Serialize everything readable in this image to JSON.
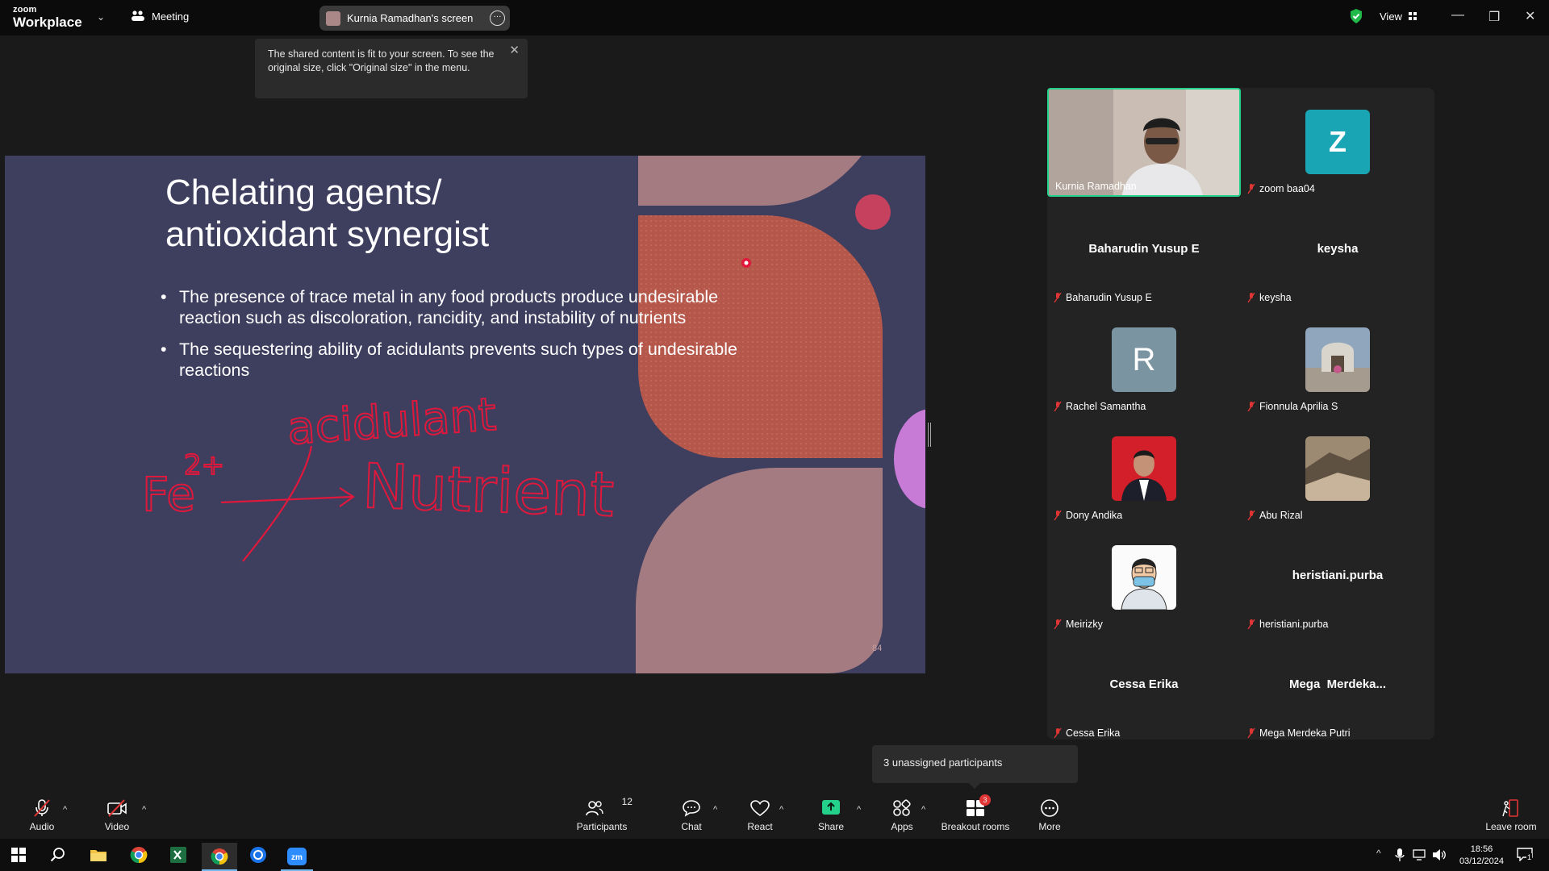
{
  "app": {
    "logo_line1": "zoom",
    "logo_line2": "Workplace"
  },
  "header": {
    "meeting_label": "Meeting",
    "screen_share_label": "Kurnia Ramadhan's screen",
    "view_label": "View"
  },
  "tooltip": {
    "text": "The shared content is fit to your screen. To see the original size, click \"Original size\" in the menu."
  },
  "slide": {
    "title_line1": "Chelating agents/",
    "title_line2": "antioxidant synergist",
    "bullets": [
      "The presence of trace metal in any food products produce undesirable reaction such as discoloration, rancidity, and instability of nutrients",
      "The sequestering ability of acidulants prevents such types of undesirable reactions"
    ],
    "annotation": {
      "top": "acidulant",
      "left": "Fe",
      "sup": "2+",
      "right": "Nutrient"
    },
    "page_number": "84",
    "colors": {
      "background": "#3e3e5f",
      "rust": "#b5574a",
      "pink": "#a47b80",
      "magenta": "#c5415d",
      "violet": "#c77bd6",
      "ink": "#e0183c"
    }
  },
  "gallery": {
    "tiles": [
      {
        "name": "Kurnia Ramadhan",
        "type": "video",
        "active": true
      },
      {
        "name": "zoom baa04",
        "type": "letter",
        "letter": "Z",
        "color": "#1aa5b4"
      },
      {
        "name": "Baharudin Yusup E",
        "type": "text",
        "center": "Baharudin Yusup E"
      },
      {
        "name": "keysha",
        "type": "text",
        "center": "keysha"
      },
      {
        "name": "Rachel Samantha",
        "type": "letter",
        "letter": "R",
        "color": "#7a95a1"
      },
      {
        "name": "Fionnula Aprilia S",
        "type": "photo"
      },
      {
        "name": "Dony Andika",
        "type": "photo"
      },
      {
        "name": "Abu Rizal",
        "type": "photo"
      },
      {
        "name": "Meirizky",
        "type": "photo"
      },
      {
        "name": "heristiani.purba",
        "type": "text",
        "center": "heristiani.purba"
      },
      {
        "name": "Cessa Erika",
        "type": "text",
        "center": "Cessa Erika"
      },
      {
        "name": "Mega Merdeka Putri",
        "type": "text",
        "center": "Mega  Merdeka..."
      }
    ]
  },
  "unassigned": {
    "text": "3 unassigned participants"
  },
  "toolbar": {
    "audio": "Audio",
    "video": "Video",
    "participants": "Participants",
    "participants_count": "12",
    "chat": "Chat",
    "react": "React",
    "share": "Share",
    "apps": "Apps",
    "breakout": "Breakout rooms",
    "breakout_badge": "3",
    "more": "More",
    "leave": "Leave room"
  },
  "taskbar": {
    "time": "18:56",
    "date": "03/12/2024",
    "notifications": "1"
  }
}
